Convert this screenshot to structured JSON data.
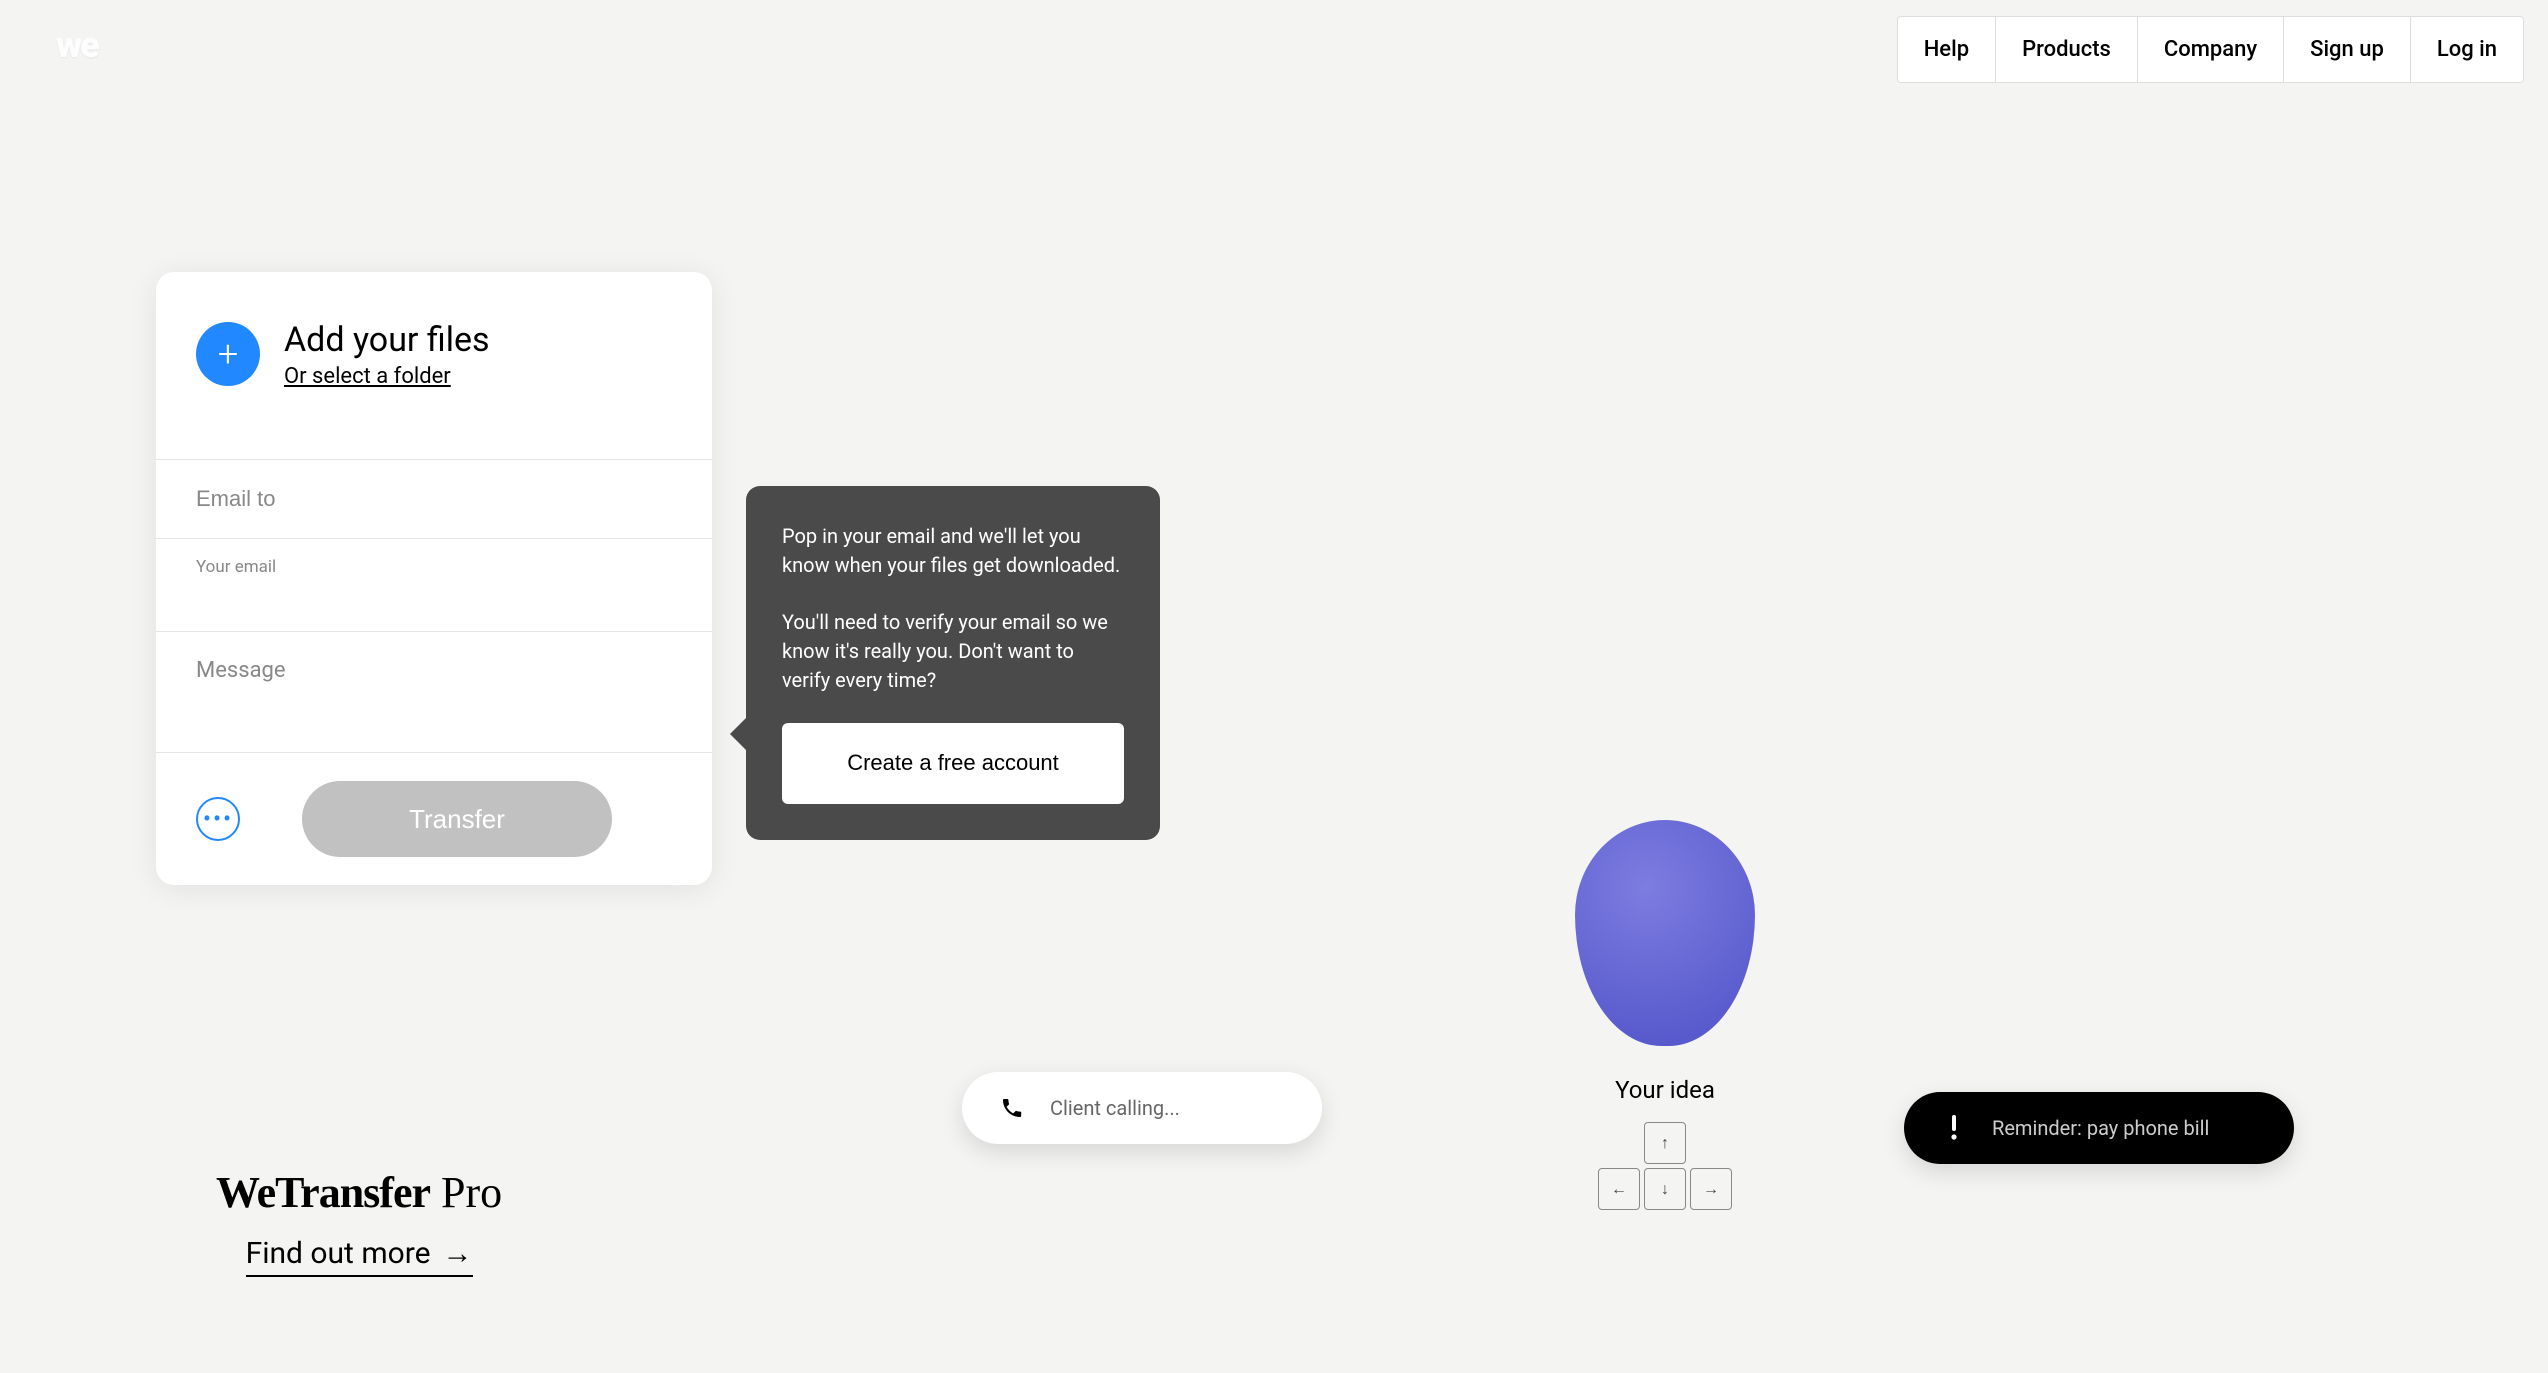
{
  "brand": {
    "logo": "we",
    "promo_brand": "WeTransfer",
    "promo_suffix": " Pro",
    "find_out_more": "Find out more"
  },
  "nav": {
    "help": "Help",
    "products": "Products",
    "company": "Company",
    "signup": "Sign up",
    "login": "Log in"
  },
  "panel": {
    "add_title": "Add your files",
    "add_subtitle": "Or select a folder",
    "email_to_placeholder": "Email to",
    "your_email_label": "Your email",
    "your_email_value": "",
    "message_placeholder": "Message",
    "transfer_label": "Transfer"
  },
  "tooltip": {
    "p1": "Pop in your email and we'll let you know when your files get downloaded.",
    "p2": "You'll need to verify your email so we know it's really you. Don't want to verify every time?",
    "cta": "Create a free account"
  },
  "bg": {
    "calling": "Client calling...",
    "reminder": "Reminder: pay phone bill",
    "idea": "Your idea"
  }
}
